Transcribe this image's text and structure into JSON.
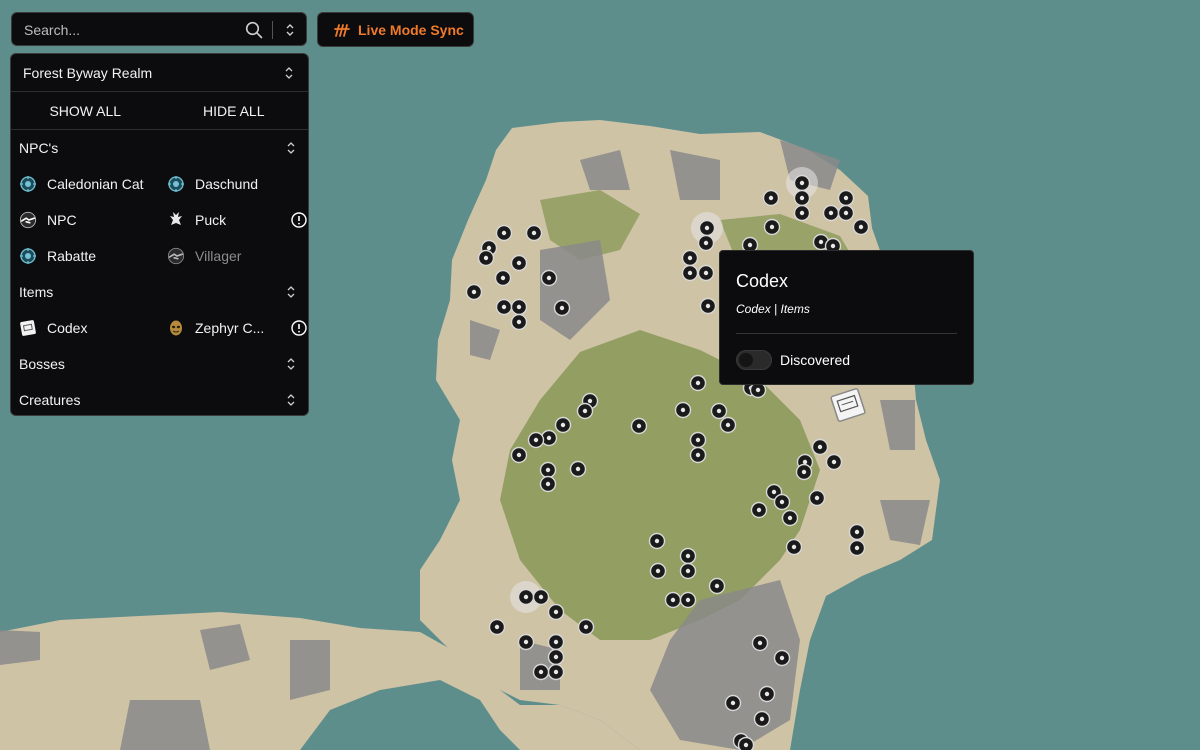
{
  "search": {
    "placeholder": "Search..."
  },
  "live_sync": {
    "label": "Live Mode Sync",
    "color": "#f07a2b"
  },
  "panel": {
    "realm": "Forest Byway Realm",
    "show_all": "SHOW ALL",
    "hide_all": "HIDE ALL",
    "sections": {
      "npcs": {
        "title": "NPC's",
        "items": [
          {
            "label": "Caledonian Cat",
            "icon": "target-icon"
          },
          {
            "label": "Daschund",
            "icon": "target-icon"
          },
          {
            "label": "NPC",
            "icon": "handshake-icon"
          },
          {
            "label": "Puck",
            "icon": "creature-icon",
            "warning": true
          },
          {
            "label": "Rabatte",
            "icon": "target-icon"
          },
          {
            "label": "Villager",
            "icon": "handshake-icon",
            "dimmed": true
          }
        ]
      },
      "items": {
        "title": "Items",
        "items": [
          {
            "label": "Codex",
            "icon": "book-icon"
          },
          {
            "label": "Zephyr C...",
            "icon": "mask-icon",
            "warning": true
          }
        ]
      },
      "bosses": {
        "title": "Bosses"
      },
      "creatures": {
        "title": "Creatures"
      }
    }
  },
  "popup": {
    "title": "Codex",
    "subtitle_item": "Codex",
    "subtitle_category": "Items",
    "toggle_label": "Discovered",
    "toggle_on": false
  },
  "map_colors": {
    "water": "#5e8e8c",
    "sand": "#cfc3a6",
    "grass": "#8f9c5e",
    "rock": "#8a8a8a",
    "marker": "#1a1a1a"
  }
}
